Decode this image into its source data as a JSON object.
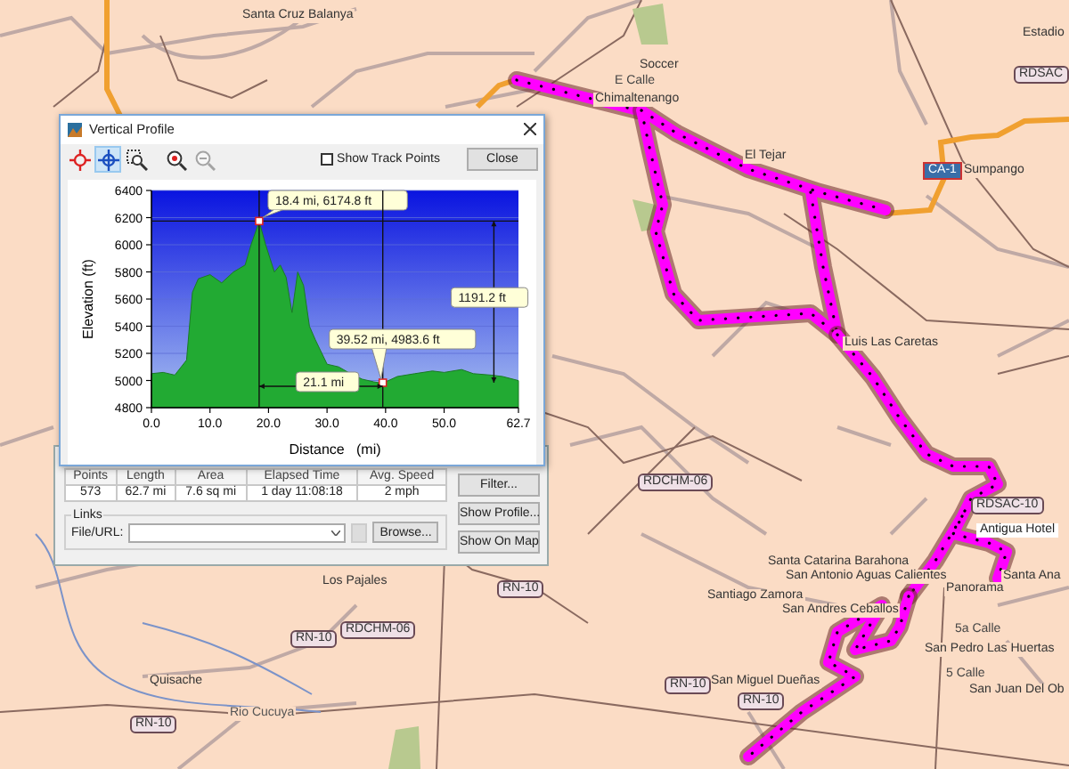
{
  "map": {
    "labels": [
      {
        "text": "Santa Cruz Balanya",
        "kind": "place"
      },
      {
        "text": "Estadio",
        "kind": "place"
      },
      {
        "text": "Soccer",
        "kind": "place"
      },
      {
        "text": "E Calle",
        "kind": "street"
      },
      {
        "text": "Chimaltenango",
        "kind": "place"
      },
      {
        "text": "El Tejar",
        "kind": "place"
      },
      {
        "text": "Sumpango",
        "kind": "place"
      },
      {
        "text": "Luis Las Caretas",
        "kind": "place"
      },
      {
        "text": "Antigua Hotel",
        "kind": "poi"
      },
      {
        "text": "Santa Catarina Barahona",
        "kind": "place"
      },
      {
        "text": "Los Pajales",
        "kind": "place"
      },
      {
        "text": "San Antonio Aguas Calientes",
        "kind": "place"
      },
      {
        "text": "Santa Ana",
        "kind": "place"
      },
      {
        "text": "Santiago Zamora",
        "kind": "place"
      },
      {
        "text": "San Andres Ceballos",
        "kind": "place"
      },
      {
        "text": "Panorama",
        "kind": "place"
      },
      {
        "text": "5a Calle",
        "kind": "street"
      },
      {
        "text": "San Pedro Las Huertas",
        "kind": "place"
      },
      {
        "text": "Quisache",
        "kind": "place"
      },
      {
        "text": "San Miguel Dueñas",
        "kind": "place"
      },
      {
        "text": "5 Calle",
        "kind": "street"
      },
      {
        "text": "San Juan Del Ob",
        "kind": "place"
      },
      {
        "text": "Rio Cucuya",
        "kind": "water"
      }
    ],
    "shields": [
      {
        "text": "CA-1",
        "kind": "highway"
      },
      {
        "text": "RDSAC",
        "kind": "local"
      },
      {
        "text": "RDSAC-10",
        "kind": "local"
      },
      {
        "text": "RDCHM-06",
        "kind": "local"
      },
      {
        "text": "RDCHM-06",
        "kind": "local"
      },
      {
        "text": "RN-10",
        "kind": "local"
      },
      {
        "text": "RN-10",
        "kind": "local"
      },
      {
        "text": "RN-10",
        "kind": "local"
      },
      {
        "text": "RN-10",
        "kind": "local"
      },
      {
        "text": "RN-10",
        "kind": "local"
      }
    ]
  },
  "properties": {
    "stats": {
      "columns": [
        "Points",
        "Length",
        "Area",
        "Elapsed Time",
        "Avg. Speed"
      ],
      "values": [
        "573",
        "62.7 mi",
        "7.6 sq mi",
        "1 day 11:08:18",
        "2 mph"
      ]
    },
    "links": {
      "title": "Links",
      "field_label": "File/URL:",
      "browse_button": "Browse..."
    },
    "buttons": [
      "Filter...",
      "Show Profile...",
      "Show On Map"
    ]
  },
  "dialog": {
    "title": "Vertical Profile",
    "toolbar": [
      {
        "kind": "marker",
        "selected": false,
        "disabled": false
      },
      {
        "kind": "crosshair",
        "selected": true,
        "disabled": false
      },
      {
        "kind": "zoombox",
        "selected": false,
        "disabled": false
      },
      {
        "kind": "zoomin",
        "selected": false,
        "disabled": false
      },
      {
        "kind": "zoomout",
        "selected": false,
        "disabled": true
      }
    ],
    "show_track_points": {
      "label": "Show Track Points",
      "checked": false
    },
    "close_button": "Close",
    "chart_data": {
      "type": "area",
      "xlabel": "Distance   (mi)",
      "ylabel": "Elevation (ft)",
      "grid": true,
      "x": [
        0,
        2,
        4,
        6,
        7,
        8,
        10,
        12,
        14,
        16,
        17,
        18.4,
        19.5,
        21,
        22,
        23,
        24,
        25,
        26,
        27,
        28,
        30,
        32,
        34,
        36,
        38,
        39.5,
        42,
        45,
        48,
        50,
        53,
        55,
        58,
        60,
        62.7
      ],
      "series": [
        {
          "color": "#22aa33",
          "values": [
            5050,
            5060,
            5040,
            5150,
            5650,
            5750,
            5780,
            5720,
            5800,
            5850,
            6000,
            6170,
            6000,
            5800,
            5850,
            5760,
            5500,
            5800,
            5700,
            5400,
            5300,
            5120,
            5100,
            5050,
            5010,
            4990,
            4980,
            5030,
            5050,
            5070,
            5060,
            5080,
            5050,
            5040,
            5030,
            5000
          ]
        }
      ],
      "xlim": [
        0,
        62.7
      ],
      "ylim": [
        4800,
        6400
      ],
      "xticks": [
        {
          "value": 0,
          "label": "0.0"
        },
        {
          "value": 10,
          "label": "10.0"
        },
        {
          "value": 20,
          "label": "20.0"
        },
        {
          "value": 30,
          "label": "30.0"
        },
        {
          "value": 40,
          "label": "40.0"
        },
        {
          "value": 50,
          "label": "50.0"
        },
        {
          "value": 62.7,
          "label": "62.7"
        }
      ],
      "yticks": [
        4800,
        5000,
        5200,
        5400,
        5600,
        5800,
        6000,
        6200,
        6400
      ],
      "annotations": [
        {
          "text": "18.4 mi, 6174.8 ft",
          "x": 18.4,
          "y": 6174.8
        },
        {
          "text": "39.52 mi, 4983.6 ft",
          "x": 39.52,
          "y": 4983.6
        },
        "21.1 mi",
        "1191.2 ft"
      ]
    }
  }
}
